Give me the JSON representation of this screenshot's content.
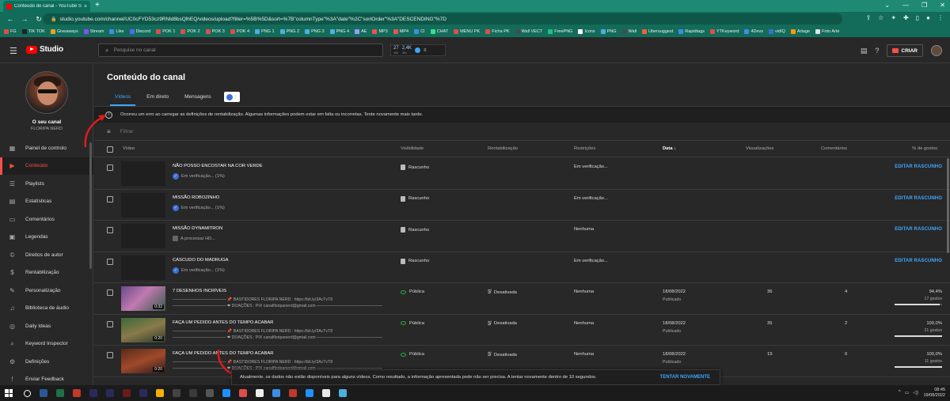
{
  "browser": {
    "tab_title": "Conteúdo do canal - YouTube St",
    "tab_close": "×",
    "new_tab": "+",
    "url": "studio.youtube.com/channel/UC0cFYD53cz9RNld8bsQlhEQ/videos/upload?filter=%5B%5D&sort=%7B\"columnType\"%3A\"date\"%2C\"sortOrder\"%3A\"DESCENDING\"%7D",
    "bookmarks": [
      "FG",
      "TIK TOK",
      "Giveaways",
      "Stream",
      "Like",
      "Discord",
      "POK 1",
      "POK 2",
      "POK 3",
      "POK 4",
      "PNG 1",
      "PNG 2",
      "PNG 3",
      "PNG 4",
      "AE",
      "MP3",
      "MP4",
      "CI",
      "CHAT",
      "MENU PK",
      "Ficha PK",
      "Wall VECT",
      "FreePNG",
      "Icons",
      "PNG",
      "Wall",
      "Ubersuggest",
      "Rapidtags",
      "YTKeyword",
      "4Devs",
      "vidIQ",
      "Artage",
      "Foto Arte"
    ]
  },
  "header": {
    "logo_text": "Studio",
    "search_placeholder": "Pesquise no canal",
    "stat1_value": "27",
    "stat1_sub": "48h",
    "stat2_value": "2,4K",
    "stat2_sub": "48h",
    "create_label": "CRIAR"
  },
  "sidebar": {
    "channel_label": "O seu canal",
    "channel_name": "FLORIPA NERD",
    "items": [
      {
        "label": "Painel de controlo",
        "icon": "▦"
      },
      {
        "label": "Conteúdo",
        "icon": "▶"
      },
      {
        "label": "Playlists",
        "icon": "☰"
      },
      {
        "label": "Estatísticas",
        "icon": "▤"
      },
      {
        "label": "Comentários",
        "icon": "▭"
      },
      {
        "label": "Legendas",
        "icon": "▣"
      },
      {
        "label": "Direitos de autor",
        "icon": "©"
      },
      {
        "label": "Rentabilização",
        "icon": "$"
      },
      {
        "label": "Personalização",
        "icon": "✎"
      },
      {
        "label": "Biblioteca de áudio",
        "icon": "♫"
      },
      {
        "label": "Daily Ideas",
        "icon": "◎"
      },
      {
        "label": "Keyword Inspector",
        "icon": "⌕"
      },
      {
        "label": "Definições",
        "icon": "⚙"
      },
      {
        "label": "Enviar Feedback",
        "icon": "!"
      }
    ]
  },
  "main": {
    "title": "Conteúdo do canal",
    "tabs": [
      "Vídeos",
      "Em direto",
      "Mensagens"
    ],
    "error": "Ocorreu um erro ao carregar as definições de rentabilização. Algumas informações podem estar em falta ou incorretas. Tente novamente mais tarde.",
    "filter_placeholder": "Filtrar",
    "columns": {
      "video": "Vídeo",
      "visibility": "Visibilidade",
      "monetization": "Rentabilização",
      "restrictions": "Restrições",
      "date": "Data",
      "views": "Visualizações",
      "comments": "Comentários",
      "likes": "% de gostos"
    },
    "rows": [
      {
        "title": "NÃO POSSO ENCOSTAR NA COR VERDE",
        "status": "Em verificação... (1%)",
        "visibility": "Rascunho",
        "restrictions": "Em verificação...",
        "action": "EDITAR RASCUNHO"
      },
      {
        "title": "MISSÃO ROBOZINHO",
        "status": "Em verificação... (1%)",
        "visibility": "Rascunho",
        "restrictions": "Em verificação...",
        "action": "EDITAR RASCUNHO"
      },
      {
        "title": "MISSÃO DYNAMITRON",
        "status": "A processar HD...",
        "visibility": "Rascunho",
        "restrictions": "Nenhuma",
        "action": "EDITAR RASCUNHO"
      },
      {
        "title": "CASCUDO DO MADRUGA",
        "status": "Em verificação... (1%)",
        "visibility": "Rascunho",
        "restrictions": "Em verificação...",
        "action": "EDITAR RASCUNHO"
      },
      {
        "title": "7 DESENHOS INCRÍVEIS",
        "duration": "0:32",
        "desc1": "————————————— 📌 BASTIDORES FLORIPA NERD : https://bit.ly/3AcTvT8",
        "desc2": "————————————— ❤ DOAÇÕES : PIX canalfloripanerd@gmail.com ————————————————",
        "visibility": "Pública",
        "monetization": "Desativada",
        "restrictions": "Nenhuma",
        "date": "18/08/2022",
        "date_sub": "Publicado",
        "views": "36",
        "comments": "4",
        "likes": "94,4%",
        "likes_sub": "17 gostos",
        "likes_pct": 94.4
      },
      {
        "title": "FAÇA UM PEDIDO ANTES DO TEMPO ACABAR",
        "duration": "0:20",
        "desc1": "————————————— 📌 BASTIDORES FLORIPA NERD : https://bit.ly/3AcTvT8",
        "desc2": "————————————— ❤ DOAÇÕES : PIX canalfloripanerd@gmail.com ————————————————",
        "visibility": "Pública",
        "monetization": "Desativada",
        "restrictions": "Nenhuma",
        "date": "18/08/2022",
        "date_sub": "Publicado",
        "views": "35",
        "comments": "2",
        "likes": "100,0%",
        "likes_sub": "21 gostos",
        "likes_pct": 100
      },
      {
        "title": "FAÇA UM PEDIDO ANTES DO TEMPO ACABAR",
        "duration": "0:20",
        "desc1": "————————————— 📌 BASTIDORES FLORIPA NERD : https://bit.ly/3AcTvT8",
        "desc2": "————————————— ❤ DOAÇÕES : PIX canalfloripanerd@gmail.com ————————————————",
        "visibility": "Pública",
        "monetization": "Desativada",
        "restrictions": "Nenhuma",
        "date": "18/08/2022",
        "date_sub": "Publicado",
        "views": "19",
        "comments": "0",
        "likes": "100,0%",
        "likes_sub": "11 gostos",
        "likes_pct": 100
      }
    ]
  },
  "snackbar": {
    "text": "Atualmente, os dados não estão disponíveis para alguns vídeos. Como resultado, a informação apresentada pode não ser precisa. A tentar novamente dentro de 10 segundos.",
    "button": "TENTAR NOVAMENTE"
  },
  "taskbar": {
    "time": "08:45",
    "date": "19/08/2022"
  },
  "colors": {
    "accent": "#3ea6ff",
    "brand": "#ff0000",
    "active_nav": "#ff4e45",
    "public": "#2ba640"
  }
}
